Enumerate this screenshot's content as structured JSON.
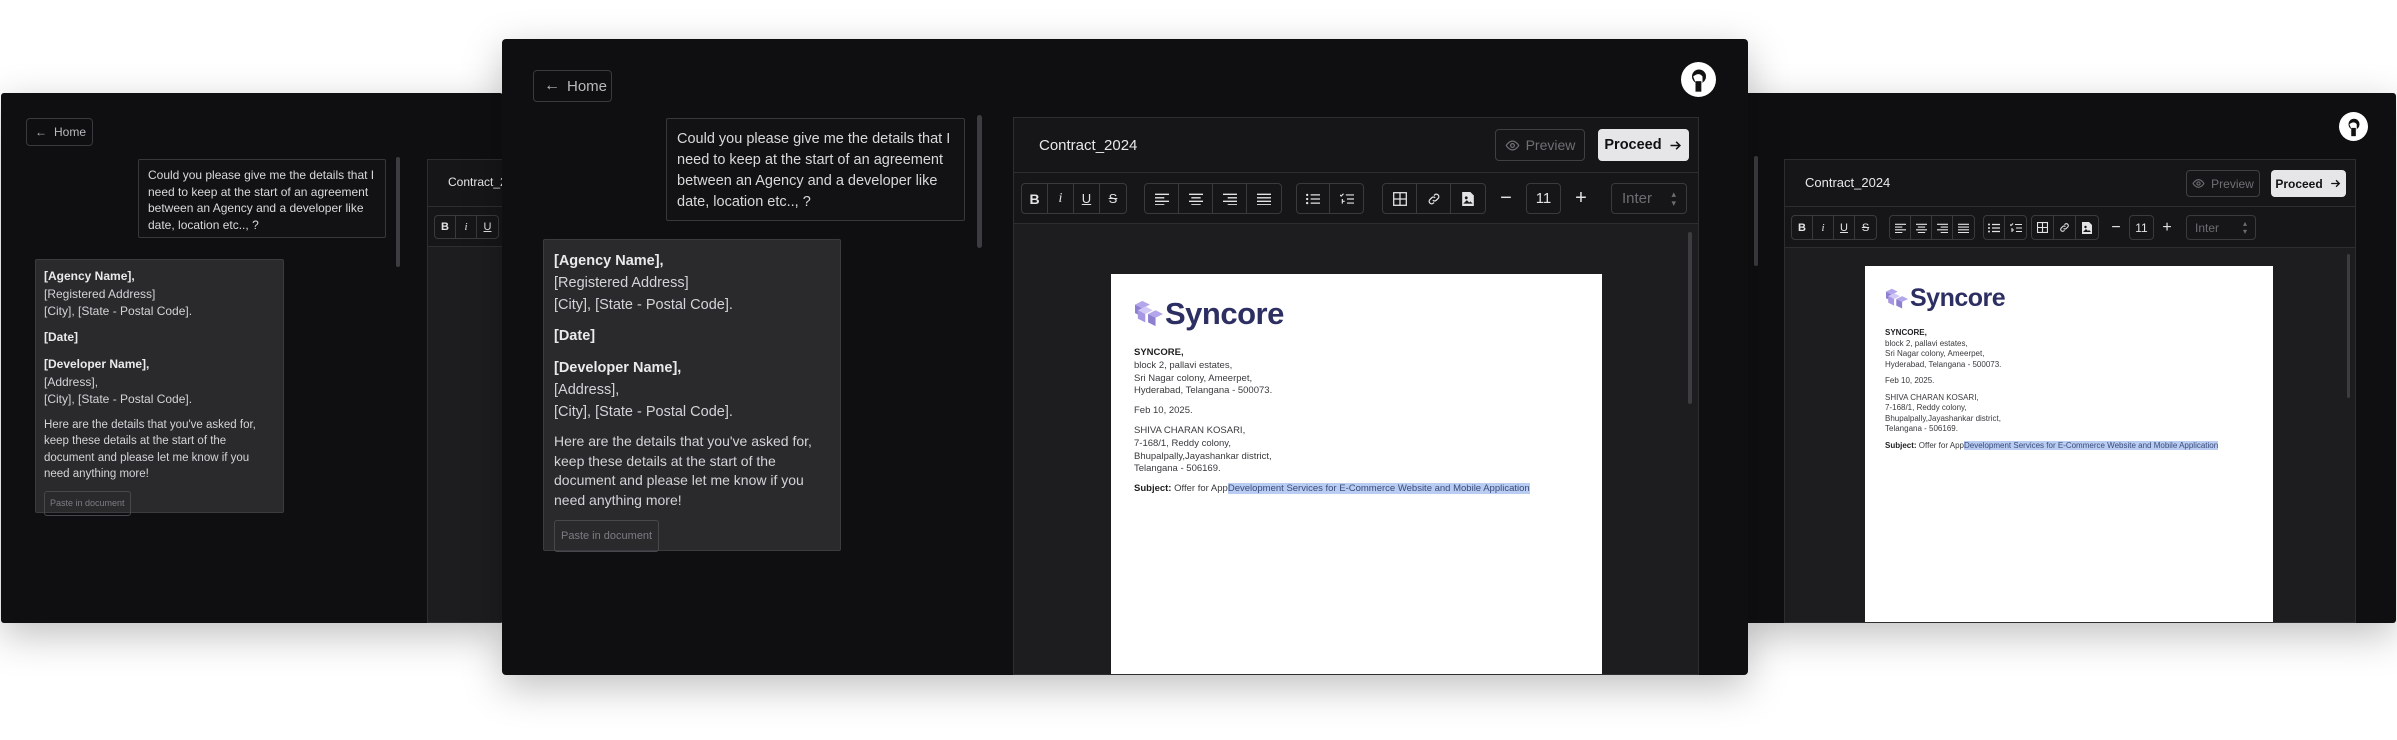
{
  "nav": {
    "home_label": "Home"
  },
  "chat": {
    "user_message": "Could you please give me the details that I need to keep at the start of an agreement between an Agency and a developer like date, location etc.., ?",
    "reply": {
      "agency_name": "[Agency Name],",
      "registered_address": "[Registered Address]",
      "agency_city": "[City], [State - Postal Code].",
      "date": "[Date]",
      "developer_name": "[Developer Name],",
      "developer_address": "[Address],",
      "developer_city": "[City], [State - Postal Code].",
      "closing": "Here are the details that you've asked for, keep these details at the start of the document and please let me know if you need anything more!"
    },
    "paste_label": "Paste in document"
  },
  "editor": {
    "doc_title": "Contract_2024",
    "preview_label": "Preview",
    "proceed_label": "Proceed",
    "toolbar": {
      "bold": "B",
      "italic": "i",
      "underline": "U",
      "strike": "S",
      "font_size": "11",
      "font_family": "Inter"
    }
  },
  "document": {
    "logo_text": "Syncore",
    "company": "SYNCORE,",
    "company_addr1": "block 2, pallavi estates,",
    "company_addr2": "Sri Nagar colony, Ameerpet,",
    "company_addr3": "Hyderabad, Telangana  - 500073.",
    "date": "Feb 10, 2025.",
    "recipient": "SHIVA CHARAN KOSARI,",
    "recipient_addr1": "7-168/1, Reddy colony,",
    "recipient_addr2": "Bhupalpally,Jayashankar district,",
    "recipient_addr3": "Telangana - 506169.",
    "subject_label": "Subject:",
    "subject_prefix": "Offer for App",
    "subject_highlight": "Development Services for E-Commerce Website and Mobile Application"
  },
  "colors": {
    "window_bg": "#0f0f11",
    "panel_bg": "#2a2a2d",
    "highlight": "#b9cdf2",
    "logo_text": "#2d2f63",
    "logo_mark": "#8e7fd0"
  }
}
